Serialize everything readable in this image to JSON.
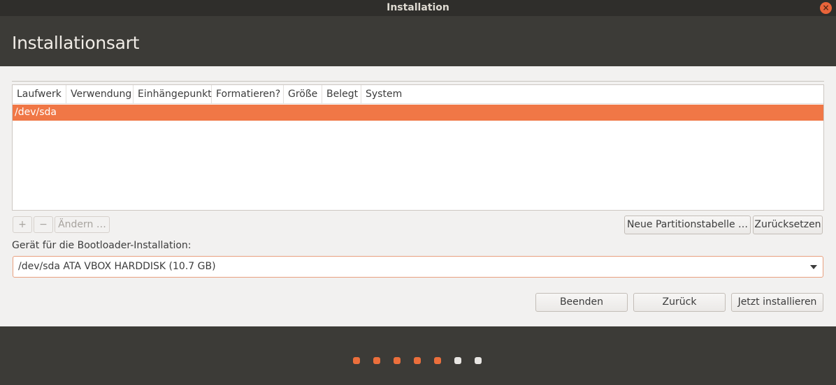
{
  "window": {
    "title": "Installation",
    "close_glyph": "×"
  },
  "header": {
    "title": "Installationsart"
  },
  "partition_table": {
    "columns": [
      "Laufwerk",
      "Verwendung",
      "Einhängepunkt",
      "Formatieren?",
      "Größe",
      "Belegt",
      "System"
    ],
    "rows": [
      {
        "device": "/dev/sda",
        "selected": true
      }
    ]
  },
  "partition_buttons": {
    "add_label": "+",
    "remove_label": "−",
    "change_label": "Ändern …",
    "new_table_label": "Neue Partitionstabelle …",
    "revert_label": "Zurücksetzen"
  },
  "bootloader": {
    "label": "Gerät für die Bootloader-Installation:",
    "selected": "/dev/sda ATA VBOX HARDDISK (10.7 GB)"
  },
  "nav_buttons": {
    "quit_label": "Beenden",
    "back_label": "Zurück",
    "install_label": "Jetzt installieren"
  },
  "progress": {
    "total_steps": 7,
    "completed_steps": 5
  },
  "colors": {
    "accent": "#f07746",
    "header_bg": "#3c3b37",
    "content_bg": "#f2f1f0"
  }
}
